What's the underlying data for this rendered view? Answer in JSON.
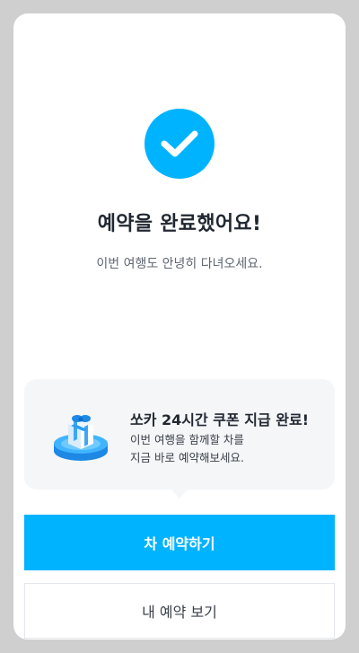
{
  "complete": {
    "title": "예약을 완료했어요!",
    "subtitle": "이번 여행도 안녕히 다녀오세요."
  },
  "coupon": {
    "title": "쏘카 24시간 쿠폰 지급 완료!",
    "desc_line1": "이번 여행을 함께할 차를",
    "desc_line2": "지금 바로 예약해보세요."
  },
  "actions": {
    "primary_label": "차 예약하기",
    "secondary_label": "내 예약 보기"
  },
  "colors": {
    "accent": "#00b3ff",
    "panel": "#f4f6f8",
    "text_dark": "#222831"
  },
  "icons": {
    "check": "check-icon",
    "gift": "gift-icon"
  }
}
